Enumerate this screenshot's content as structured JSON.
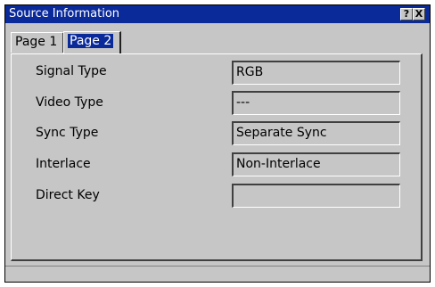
{
  "window": {
    "title": "Source Information",
    "help_glyph": "?",
    "close_glyph": "X"
  },
  "tabs": [
    {
      "label": "Page 1",
      "selected": false
    },
    {
      "label": "Page 2",
      "selected": true
    }
  ],
  "rows": [
    {
      "label": "Signal Type",
      "value": "RGB"
    },
    {
      "label": "Video Type",
      "value": "---"
    },
    {
      "label": "Sync Type",
      "value": "Separate Sync"
    },
    {
      "label": "Interlace",
      "value": "Non-Interlace"
    },
    {
      "label": "Direct Key",
      "value": ""
    }
  ],
  "colors": {
    "title_bar": "#0a2a9a",
    "window_bg": "#c6c6c6",
    "selected_tab_highlight": "#0a2a9a"
  }
}
